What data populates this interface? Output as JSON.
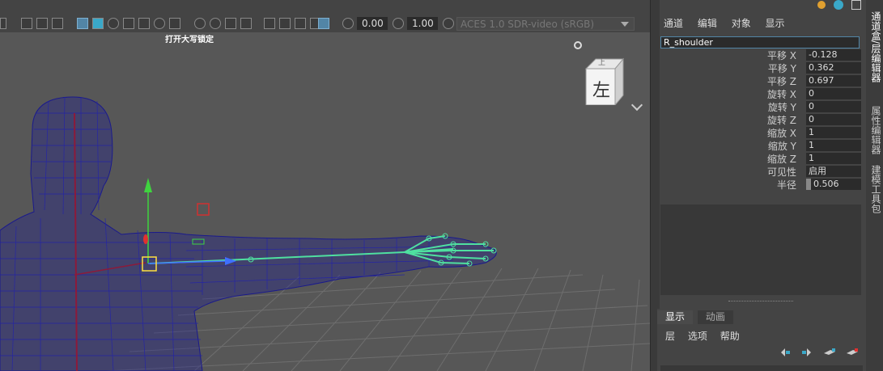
{
  "toolbar": {
    "exposure_value": "0.00",
    "gamma_value": "1.00",
    "color_space": "ACES 1.0 SDR-video (sRGB)"
  },
  "viewport": {
    "caps_lock_label": "打开大写锁定",
    "view_cube_label": "左",
    "view_cube_top_label": "上"
  },
  "channel_box": {
    "menu": [
      "通道",
      "编辑",
      "对象",
      "显示"
    ],
    "object_name": "R_shoulder",
    "attributes": [
      {
        "label": "平移 X",
        "value": "-0.128"
      },
      {
        "label": "平移 Y",
        "value": "0.362"
      },
      {
        "label": "平移 Z",
        "value": "0.697"
      },
      {
        "label": "旋转 X",
        "value": "0"
      },
      {
        "label": "旋转 Y",
        "value": "0"
      },
      {
        "label": "旋转 Z",
        "value": "0"
      },
      {
        "label": "缩放 X",
        "value": "1"
      },
      {
        "label": "缩放 Y",
        "value": "1"
      },
      {
        "label": "缩放 Z",
        "value": "1"
      },
      {
        "label": "可见性",
        "value": "启用"
      },
      {
        "label": "半径",
        "value": "0.506"
      }
    ]
  },
  "layer_editor": {
    "tabs": [
      "显示",
      "动画"
    ],
    "active_tab": "显示",
    "menu": [
      "层",
      "选项",
      "帮助"
    ]
  },
  "side_tabs": [
    "通道盒/层编辑器",
    "属性编辑器",
    "建模工具包"
  ],
  "colors": {
    "accent": "#5285a6",
    "wireframe": "#1a1a8c",
    "joint": "#4fe0a0"
  }
}
